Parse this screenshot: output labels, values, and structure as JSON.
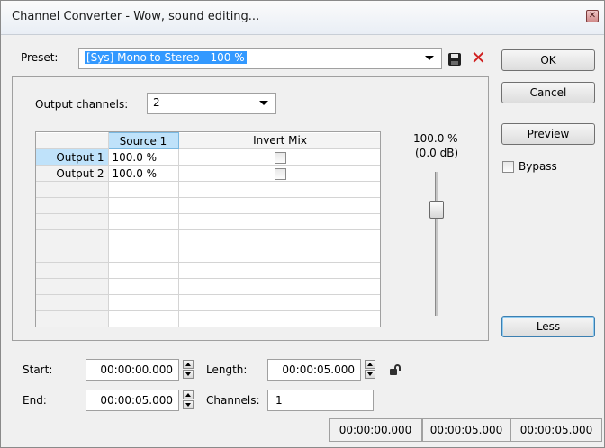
{
  "window": {
    "title": "Channel Converter - Wow, sound editing..."
  },
  "preset": {
    "label": "Preset:",
    "value": "[Sys] Mono to Stereo - 100 %"
  },
  "buttons": {
    "ok": "OK",
    "cancel": "Cancel",
    "preview": "Preview",
    "less": "Less"
  },
  "bypass": {
    "label": "Bypass",
    "checked": false
  },
  "output_channels": {
    "label": "Output channels:",
    "value": "2"
  },
  "grid": {
    "headers": [
      "",
      "Source 1",
      "Invert Mix"
    ],
    "rows": [
      {
        "name": "Output 1",
        "source": "100.0 %",
        "invert": false
      },
      {
        "name": "Output 2",
        "source": "100.0 %",
        "invert": false
      }
    ],
    "empty_rows": 8
  },
  "level": {
    "percent": "100.0 %",
    "db": "(0.0 dB)"
  },
  "time": {
    "start_label": "Start:",
    "start_value": "00:00:00.000",
    "length_label": "Length:",
    "length_value": "00:00:05.000",
    "end_label": "End:",
    "end_value": "00:00:05.000",
    "channels_label": "Channels:",
    "channels_value": "1"
  },
  "status": [
    "00:00:00.000",
    "00:00:05.000",
    "00:00:05.000"
  ],
  "colors": {
    "selection": "#3399ff",
    "header_highlight": "#bfe2fa",
    "delete_red": "#d02020"
  }
}
